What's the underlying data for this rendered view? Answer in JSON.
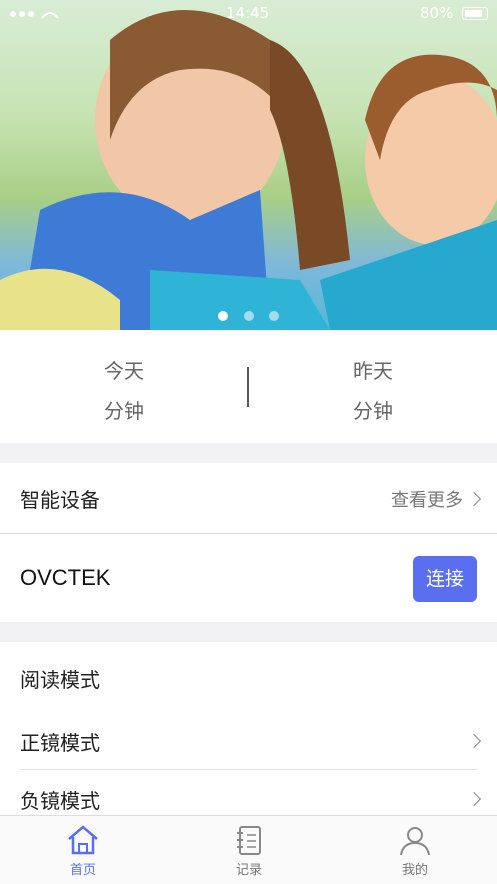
{
  "status": {
    "time": "14:45",
    "battery": "80%"
  },
  "hero": {
    "slides": 3,
    "active_slide": 1
  },
  "stats": {
    "today_label": "今天",
    "today_unit": "分钟",
    "yesterday_label": "昨天",
    "yesterday_unit": "分钟"
  },
  "devices": {
    "title": "智能设备",
    "more": "查看更多",
    "device_name": "OVCTEK",
    "connect": "连接"
  },
  "modes": {
    "reading": "阅读模式",
    "positive": "正镜模式",
    "negative": "负镜模式"
  },
  "tabs": [
    {
      "label": "首页",
      "icon": "home-icon",
      "active": true
    },
    {
      "label": "记录",
      "icon": "notebook-icon",
      "active": false
    },
    {
      "label": "我的",
      "icon": "user-icon",
      "active": false
    }
  ],
  "colors": {
    "accent": "#5a6ef0"
  }
}
